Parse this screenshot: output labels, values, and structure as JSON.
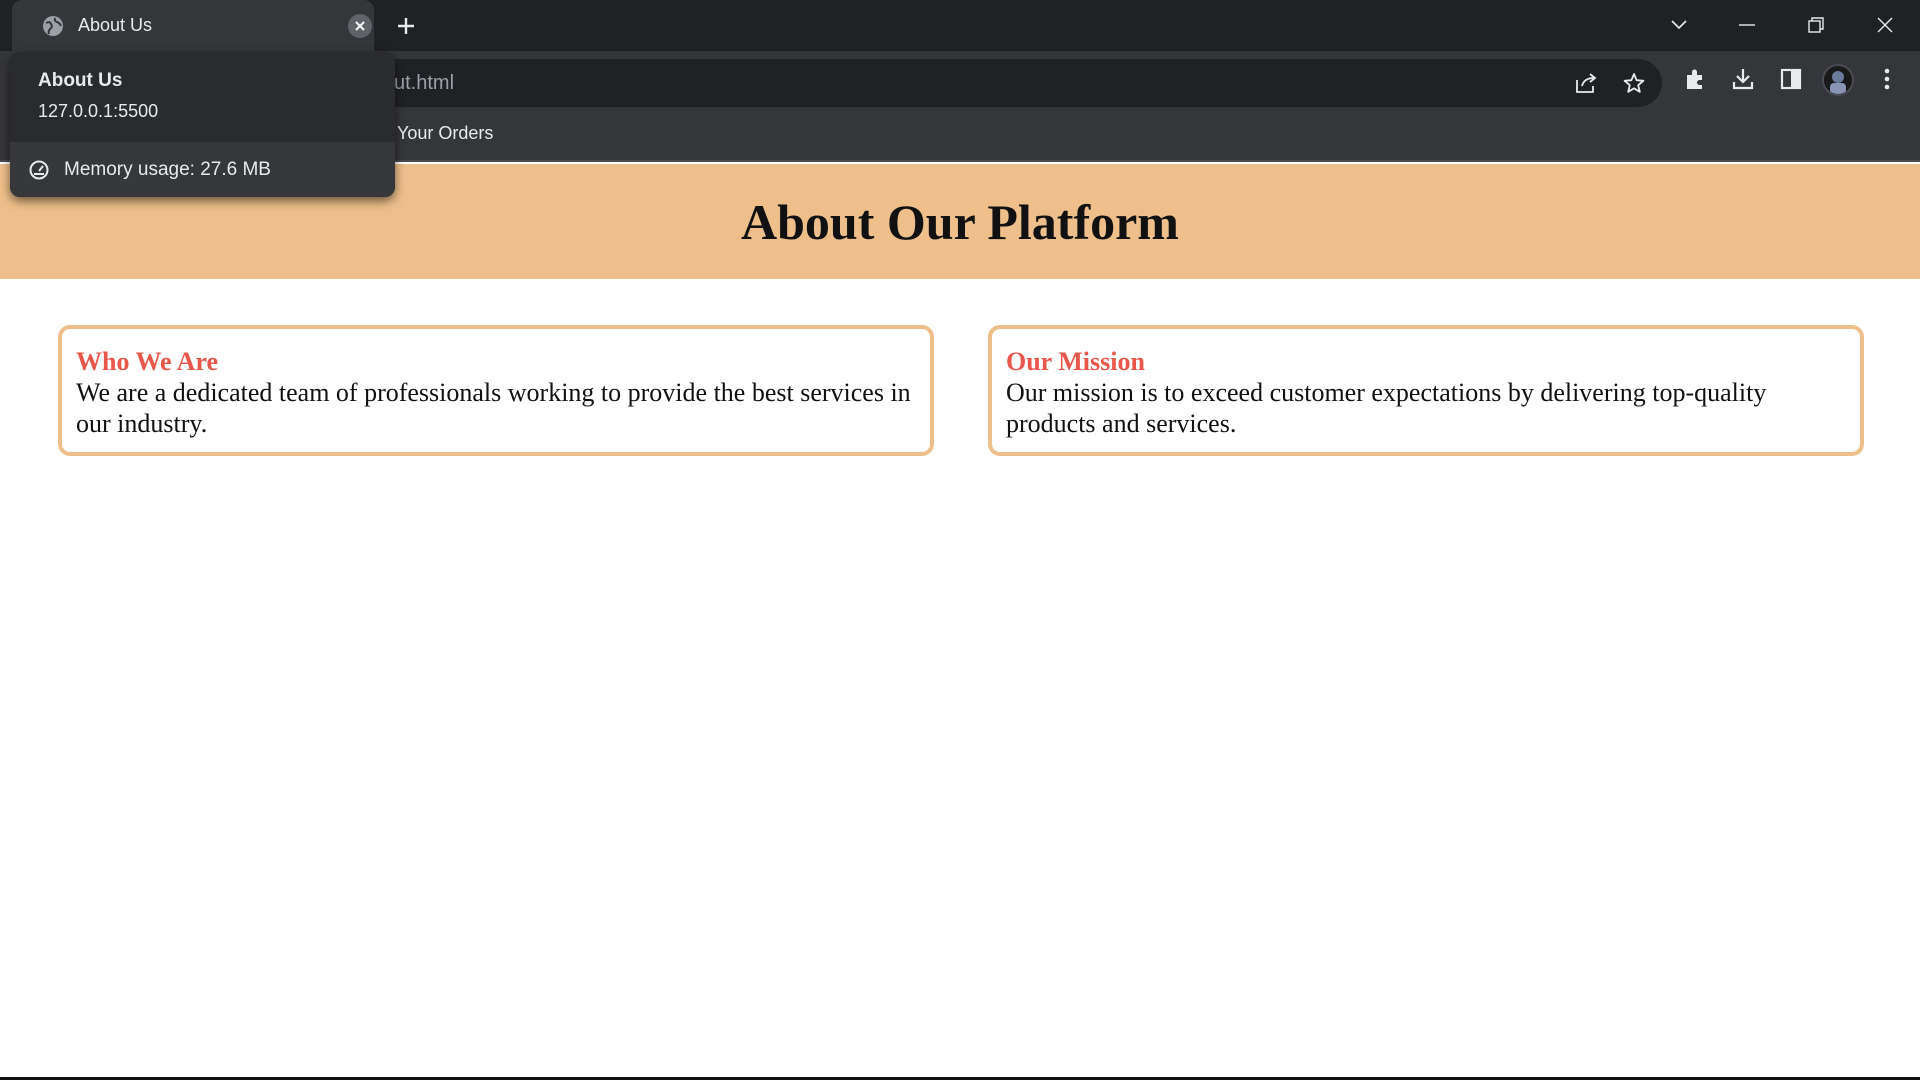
{
  "browser": {
    "tab": {
      "title": "About Us",
      "favicon": "globe-icon"
    },
    "url_visible": "ut.html",
    "bookmarks": [
      "Your Orders"
    ],
    "hover_card": {
      "title": "About Us",
      "url": "127.0.0.1:5500",
      "memory": "Memory usage: 27.6 MB"
    }
  },
  "page": {
    "title": "About Our Platform",
    "cards": [
      {
        "heading": "Who We Are",
        "body": "We are a dedicated team of professionals working to provide the best services in our industry."
      },
      {
        "heading": "Our Mission",
        "body": "Our mission is to exceed customer expectations by delivering top-quality products and services."
      }
    ]
  },
  "colors": {
    "header_bg": "#eebf8b",
    "card_border": "#eebf8b",
    "card_heading": "#e8574a",
    "chrome_dark": "#202124",
    "chrome_mid": "#35363a"
  }
}
